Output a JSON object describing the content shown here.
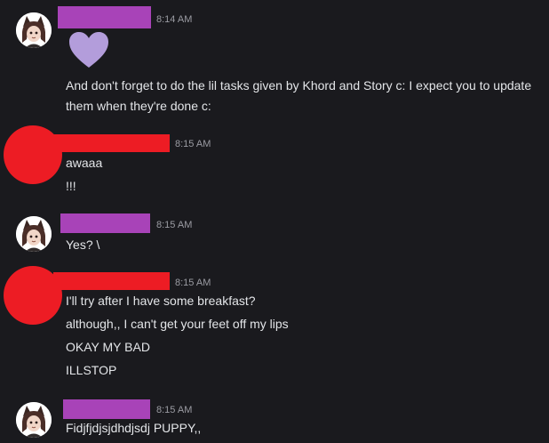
{
  "messages": [
    {
      "time": "8:14 AM",
      "emoji": "purple-heart",
      "text": "And don't forget to do the lil tasks given by Khord and Story c: I expect you to update them when they're done c:"
    },
    {
      "time": "8:15 AM",
      "lines": [
        "awaaa",
        "!!!"
      ]
    },
    {
      "time": "8:15 AM",
      "lines": [
        "Yes? \\"
      ]
    },
    {
      "time": "8:15 AM",
      "lines": [
        "I'll try after I have some breakfast?",
        "although,, I can't get your feet off my lips",
        "OKAY MY BAD",
        "ILLSTOP"
      ]
    },
    {
      "time": "8:15 AM",
      "lines": [
        "Fidjfjdjsjdhdjsdj PUPPY,,"
      ]
    }
  ],
  "colors": {
    "background": "#1a1a1e",
    "redact_purple": "#a843b8",
    "redact_red": "#ed1c24",
    "heart": "#b39ddb",
    "timestamp": "#9b9ca3"
  }
}
